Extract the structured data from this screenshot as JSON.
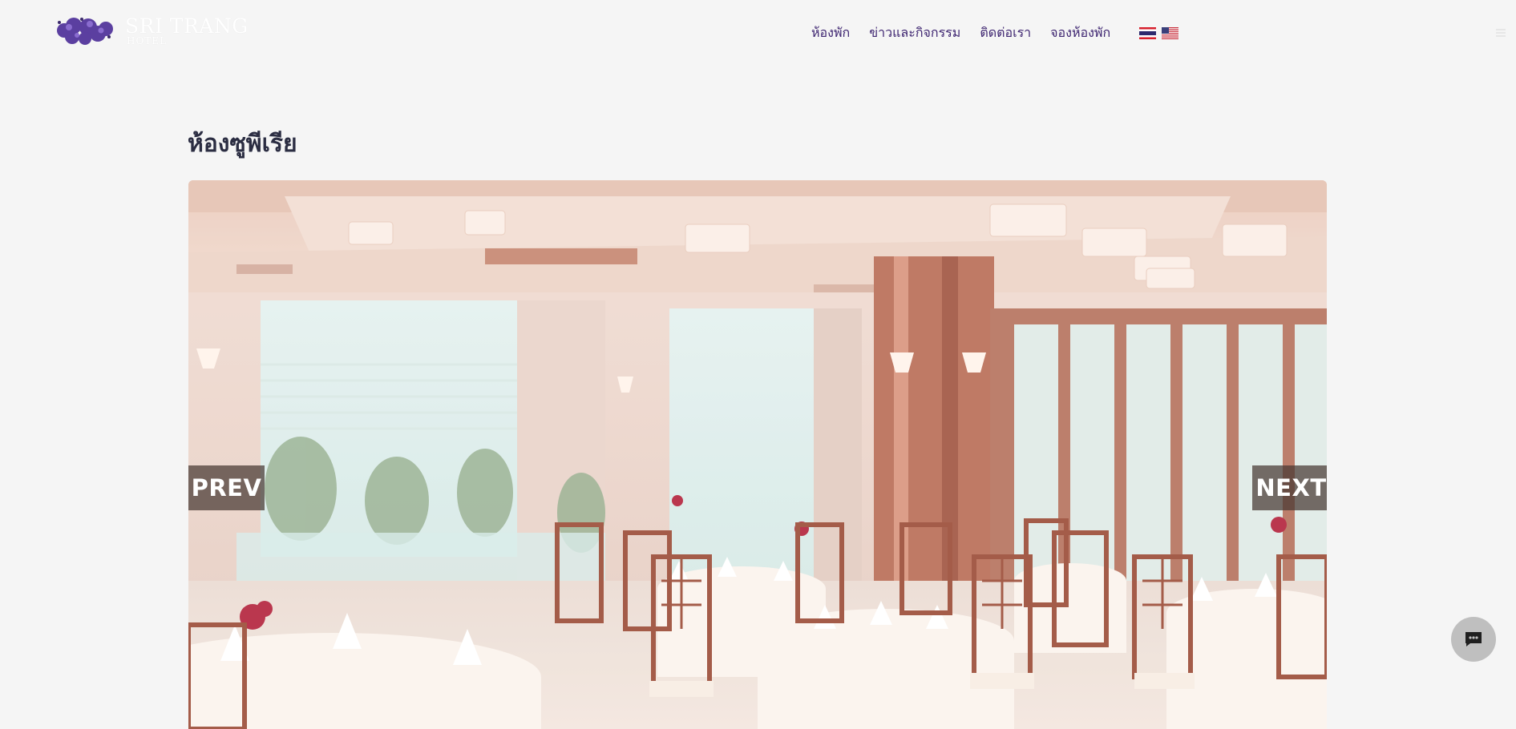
{
  "brand": {
    "name": "SRI TRANG",
    "sub": "HOTEL",
    "logo_icon": "flower-cluster-icon",
    "text_color": "#ffffff"
  },
  "nav": {
    "items": [
      {
        "label": "ห้องพัก"
      },
      {
        "label": "ข่าวและกิจกรรม"
      },
      {
        "label": "ติดต่อเรา"
      },
      {
        "label": "จองห้องพัก"
      }
    ],
    "color": "#3d2470",
    "languages": [
      {
        "icon": "thai-flag-icon"
      },
      {
        "icon": "us-flag-icon"
      }
    ]
  },
  "page": {
    "title": "ห้องซูพีเรีย"
  },
  "carousel": {
    "prev_label": "PREV",
    "next_label": "NEXT",
    "image_subject": "hotel restaurant dining room"
  },
  "chat": {
    "icon": "chat-bubble-icon"
  }
}
